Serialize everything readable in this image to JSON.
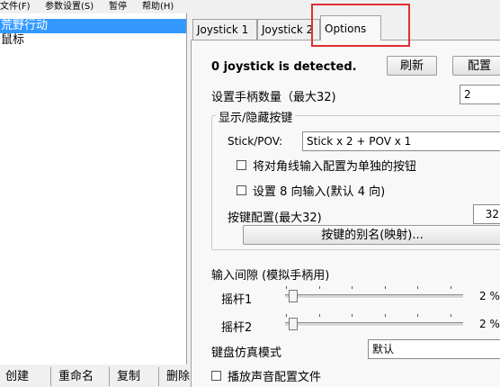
{
  "menu": {
    "file": "文件(F)",
    "settings": "参数设置(S)",
    "pause": "暂停",
    "help": "帮助(H)"
  },
  "profiles": {
    "items": [
      {
        "label": "荒野行动",
        "selected": true
      },
      {
        "label": "鼠标",
        "selected": false
      }
    ]
  },
  "bottom_buttons": {
    "create": "创建",
    "rename": "重命名",
    "copy": "复制",
    "delete": "删除"
  },
  "tabs": {
    "joystick1": "Joystick 1",
    "joystick2": "Joystick 2",
    "options": "Options",
    "active": "Options"
  },
  "options": {
    "detected_text": "0 joystick is detected.",
    "refresh_button": "刷新",
    "config_button": "配置",
    "joystick_count_label": "设置手柄数量（最大32)",
    "joystick_count_value": "2",
    "show_hide_group": "显示/隐藏按键",
    "stick_pov_label": "Stick/POV:",
    "stick_pov_value": "Stick x 2 + POV x 1",
    "diagonal_checkbox": {
      "label": "将对角线输入配置为单独的按钮",
      "checked": false
    },
    "eight_dir_checkbox": {
      "label": "设置 8 向输入(默认 4 向)",
      "checked": false
    },
    "button_config_label": "按键配置(最大32)",
    "button_config_value": "32",
    "alias_button": "按键的别名(映射)...",
    "input_gap_label": "输入间隙 (模拟手柄用)",
    "stick1_label": "摇杆1",
    "stick1_value": "2 %",
    "stick1_level": 0.02,
    "stick2_label": "摇杆2",
    "stick2_value": "2 %",
    "stick2_level": 0.02,
    "keyboard_mode_label": "键盘仿真模式",
    "keyboard_mode_value": "默认",
    "play_sound_checkbox": {
      "label": "播放声音配置文件",
      "checked": false
    }
  },
  "colors": {
    "selection": "#3399ff",
    "highlight_box": "#e03030"
  }
}
